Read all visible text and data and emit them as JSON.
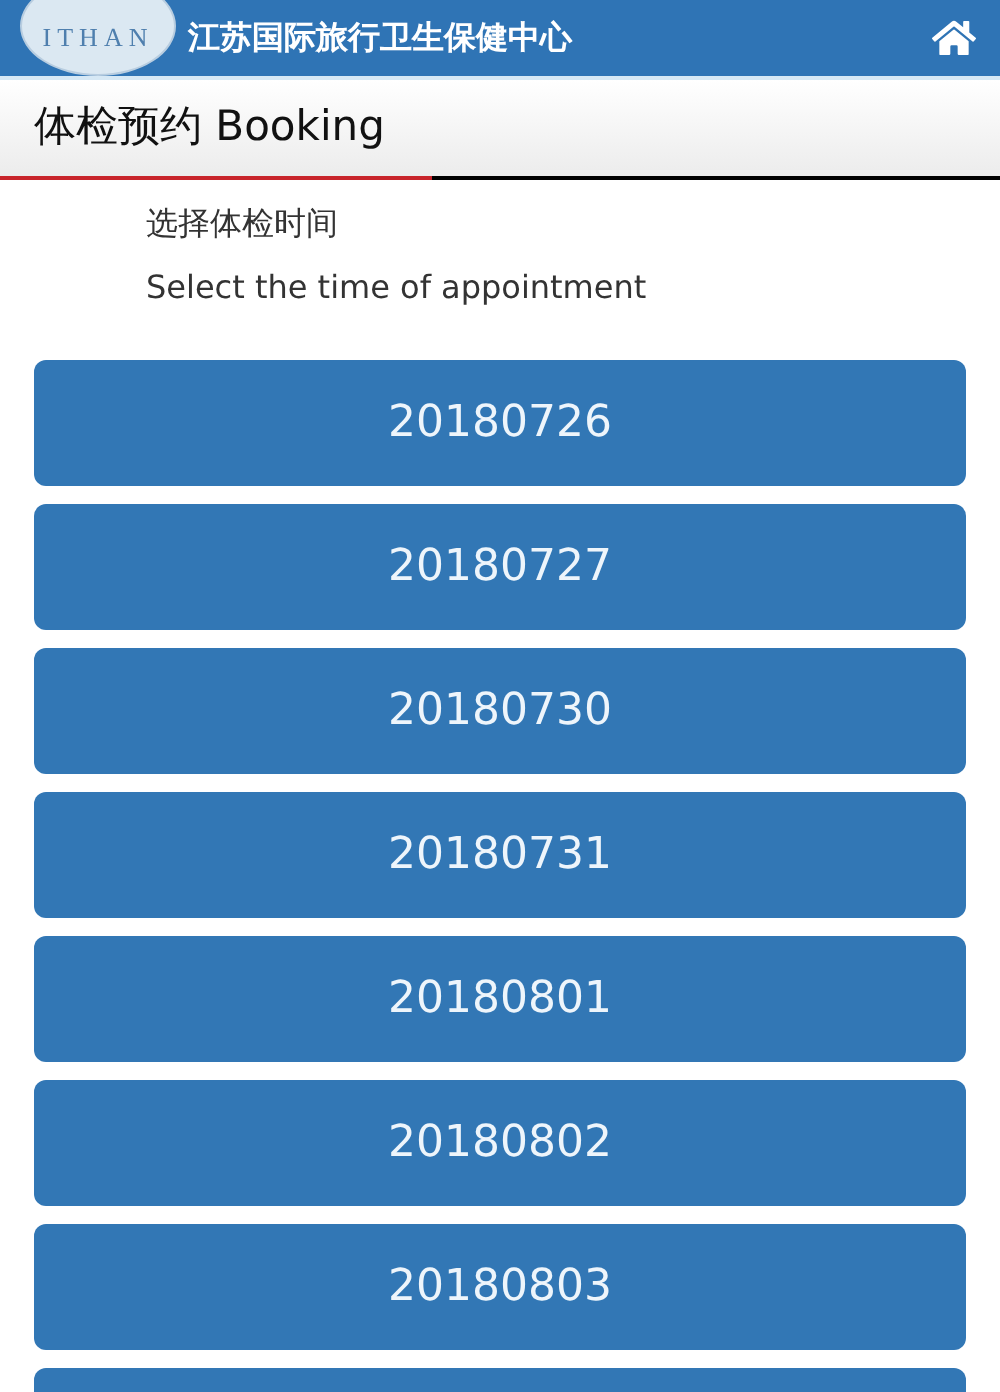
{
  "header": {
    "logo_text": "ITHAN",
    "title": "江苏国际旅行卫生保健中心"
  },
  "page_title": "体检预约 Booking",
  "instructions": [
    "选择体检时间",
    "Select the time of appointment"
  ],
  "dates": [
    {
      "label": "20180726"
    },
    {
      "label": "20180727"
    },
    {
      "label": "20180730"
    },
    {
      "label": "20180731"
    },
    {
      "label": "20180801"
    },
    {
      "label": "20180802"
    },
    {
      "label": "20180803"
    }
  ],
  "more_below": true
}
